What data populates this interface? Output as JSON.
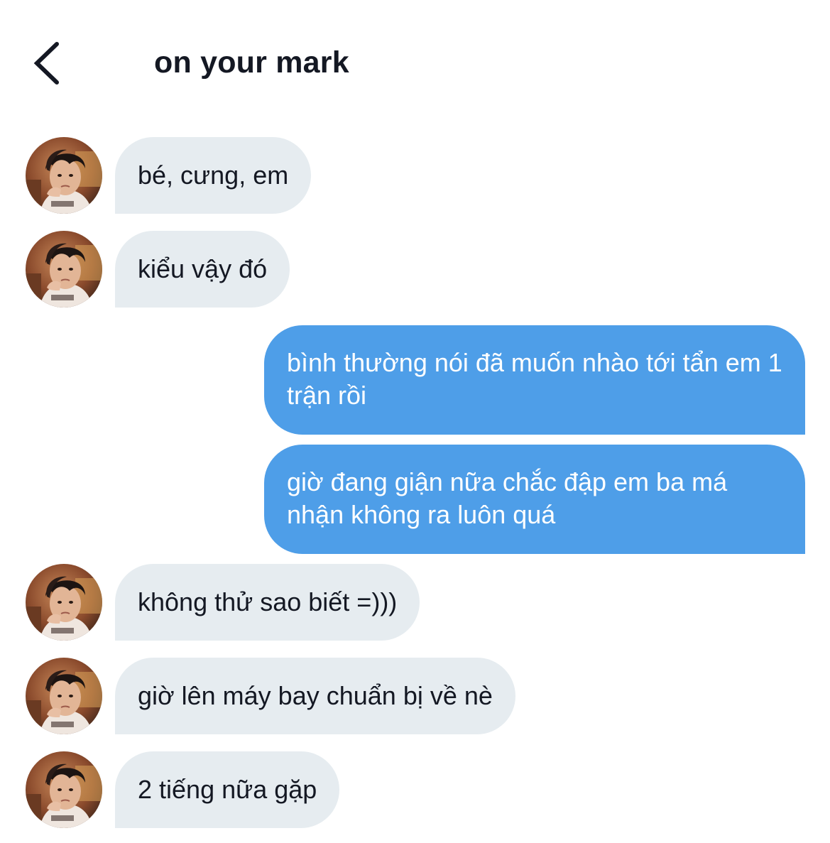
{
  "header": {
    "title": "on your mark",
    "back_icon": "chevron-left-icon"
  },
  "colors": {
    "incoming_bubble": "#e6ecf0",
    "outgoing_bubble": "#4e9ee8",
    "text_dark": "#141823",
    "text_light": "#ffffff"
  },
  "messages": [
    {
      "direction": "incoming",
      "text": "bé, cưng, em"
    },
    {
      "direction": "incoming",
      "text": "kiểu vậy đó"
    },
    {
      "direction": "outgoing",
      "text": "bình thường nói đã muốn nhào tới tẩn em 1 trận rồi"
    },
    {
      "direction": "outgoing",
      "text": "giờ đang giận nữa chắc đập em ba má nhận không ra luôn quá"
    },
    {
      "direction": "incoming",
      "text": "không thử sao biết =)))"
    },
    {
      "direction": "incoming",
      "text": "giờ lên máy bay chuẩn bị về nè"
    },
    {
      "direction": "incoming",
      "text": "2 tiếng nữa gặp"
    }
  ]
}
